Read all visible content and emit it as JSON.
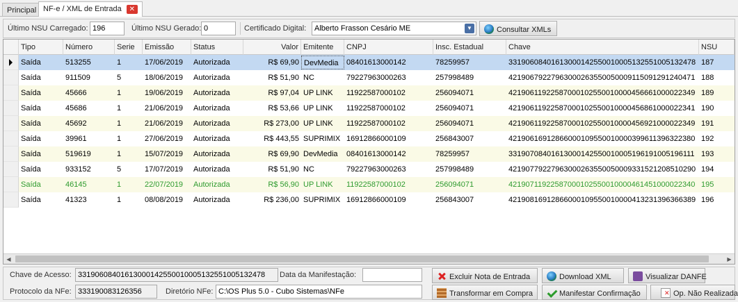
{
  "tabs": [
    {
      "label": "Principal"
    },
    {
      "label": "NF-e / XML de Entrada"
    }
  ],
  "toolbar": {
    "ultimo_nsu_carregado_label": "Último NSU Carregado:",
    "ultimo_nsu_carregado_value": "196",
    "ultimo_nsu_gerado_label": "Último NSU Gerado:",
    "ultimo_nsu_gerado_value": "0",
    "certificado_label": "Certificado Digital:",
    "certificado_value": "Alberto Frasson Cesário ME",
    "consultar_label": "Consultar XMLs"
  },
  "grid": {
    "columns": [
      "Tipo",
      "Número",
      "Serie",
      "Emissão",
      "Status",
      "Valor",
      "Emitente",
      "CNPJ",
      "Insc. Estadual",
      "Chave",
      "NSU"
    ],
    "rows": [
      [
        "Saída",
        "513255",
        "1",
        "17/06/2019",
        "Autorizada",
        "R$ 69,90",
        "DevMedia",
        "08401613000142",
        "78259957",
        "33190608401613000142550010005132551005132478",
        "187"
      ],
      [
        "Saída",
        "911509",
        "5",
        "18/06/2019",
        "Autorizada",
        "R$ 51,90",
        "NC",
        "79227963000263",
        "257998489",
        "42190679227963000263550050009115091291240471",
        "188"
      ],
      [
        "Saída",
        "45666",
        "1",
        "19/06/2019",
        "Autorizada",
        "R$ 97,04",
        "UP LINK",
        "11922587000102",
        "256094071",
        "42190611922587000102550010000456661000022349",
        "189"
      ],
      [
        "Saída",
        "45686",
        "1",
        "21/06/2019",
        "Autorizada",
        "R$ 53,66",
        "UP LINK",
        "11922587000102",
        "256094071",
        "42190611922587000102550010000456861000022341",
        "190"
      ],
      [
        "Saída",
        "45692",
        "1",
        "21/06/2019",
        "Autorizada",
        "R$ 273,00",
        "UP LINK",
        "11922587000102",
        "256094071",
        "42190611922587000102550010000456921000022349",
        "191"
      ],
      [
        "Saída",
        "39961",
        "1",
        "27/06/2019",
        "Autorizada",
        "R$ 443,55",
        "SUPRIMIX",
        "16912866000109",
        "256843007",
        "42190616912866000109550010000399611396322380",
        "192"
      ],
      [
        "Saída",
        "519619",
        "1",
        "15/07/2019",
        "Autorizada",
        "R$ 69,90",
        "DevMedia",
        "08401613000142",
        "78259957",
        "33190708401613000142550010005196191005196111",
        "193"
      ],
      [
        "Saída",
        "933152",
        "5",
        "17/07/2019",
        "Autorizada",
        "R$ 51,90",
        "NC",
        "79227963000263",
        "257998489",
        "42190779227963000263550050009331521208510290",
        "194"
      ],
      [
        "Saída",
        "46145",
        "1",
        "22/07/2019",
        "Autorizada",
        "R$ 56,90",
        "UP LINK",
        "11922587000102",
        "256094071",
        "42190711922587000102550010000461451000022340",
        "195"
      ],
      [
        "Saída",
        "41323",
        "1",
        "08/08/2019",
        "Autorizada",
        "R$ 236,00",
        "SUPRIMIX",
        "16912866000109",
        "256843007",
        "42190816912866000109550010000413231396366389",
        "196"
      ]
    ],
    "selected_row": 0,
    "highlight_row": 8,
    "highlight_color": "#2f9b2f"
  },
  "footer": {
    "chave_label": "Chave de Acesso:",
    "chave_value": "33190608401613000142550010005132551005132478",
    "data_manifestacao_label": "Data da Manifestação:",
    "data_manifestacao_value": "",
    "protocolo_label": "Protocolo da NFe:",
    "protocolo_value": "333190083126356",
    "diretorio_label": "Diretório NFe:",
    "diretorio_value": "C:\\OS Plus 5.0 - Cubo Sistemas\\NFe",
    "buttons": {
      "excluir": "Excluir Nota de Entrada",
      "download": "Download XML",
      "visualizar": "Visualizar DANFE",
      "transformar": "Transformar em Compra",
      "manifestar": "Manifestar Confirmação",
      "nao_realizada": "Op. Não Realizada"
    }
  },
  "icons": [
    "close-icon",
    "globe-icon",
    "dropdown-arrow-icon",
    "delete-icon",
    "printer-icon",
    "bricks-icon",
    "checkmark-icon",
    "document-x-icon"
  ]
}
